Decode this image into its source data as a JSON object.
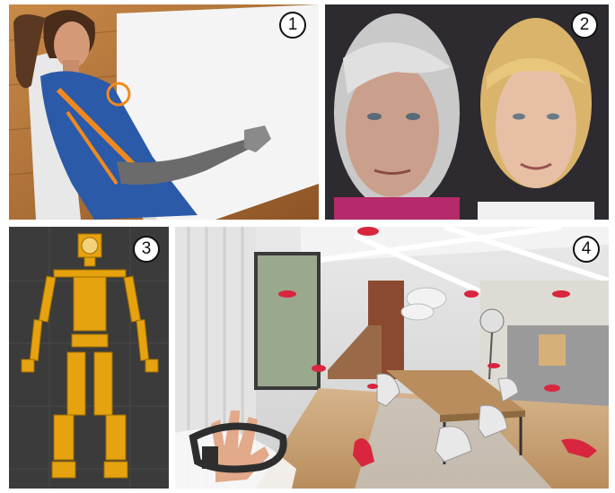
{
  "panels": [
    {
      "label": "1",
      "content": "avatar-seated-at-table"
    },
    {
      "label": "2",
      "content": "two-avatar-faces"
    },
    {
      "label": "3",
      "content": "skeleton-rig"
    },
    {
      "label": "4",
      "content": "vr-loft-scene"
    }
  ],
  "colors": {
    "floor_wood": "#b97a3c",
    "table_white": "#f2f2f2",
    "suit_blue": "#2b5aa8",
    "suit_orange": "#f08a1f",
    "face_bg": "#2d2a30",
    "rig_bg": "#3b3b3b",
    "rig_bone": "#e6a20f",
    "glove_red": "#d7263d"
  }
}
